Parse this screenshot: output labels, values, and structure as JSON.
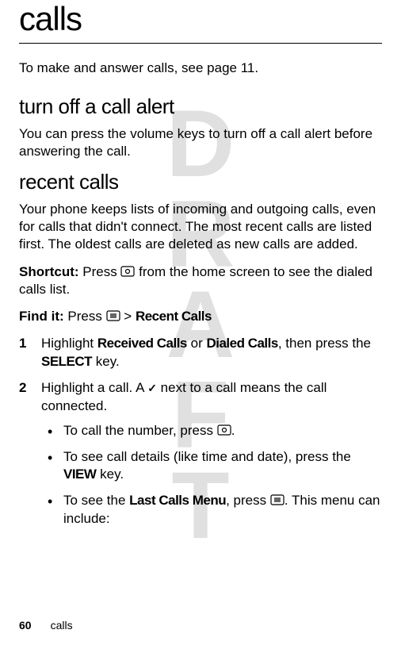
{
  "watermark": "DRAFT",
  "title": "calls",
  "intro": "To make and answer calls, see page 11.",
  "sections": {
    "turn_off": {
      "heading": "turn off a call alert",
      "body": "You can press the volume keys to turn off a call alert before answering the call."
    },
    "recent": {
      "heading": "recent calls",
      "body": "Your phone keeps lists of incoming and outgoing calls, even for calls that didn't connect. The most recent calls are listed first. The oldest calls are deleted as new calls are added.",
      "shortcut_label": "Shortcut:",
      "shortcut_pre": " Press ",
      "shortcut_post": " from the home screen to see the dialed calls list.",
      "shortcut_icon": "send-key-icon",
      "findit_label": "Find it:",
      "findit_pre": " Press ",
      "findit_sep": " > ",
      "findit_menu": "Recent Calls",
      "findit_icon": "menu-key-icon",
      "steps": {
        "s1_a": "Highlight ",
        "s1_b": "Received Calls",
        "s1_c": " or ",
        "s1_d": "Dialed Calls",
        "s1_e": ", then press the ",
        "s1_f": "SELECT",
        "s1_g": " key.",
        "s2_a": "Highlight a call. A ",
        "s2_b": " next to a call means the call connected.",
        "s2_check": "✓"
      },
      "bullets": {
        "b1_a": "To call the number, press ",
        "b1_b": ".",
        "b1_icon": "send-key-icon",
        "b2_a": "To see call details (like time and date), press the ",
        "b2_b": "VIEW",
        "b2_c": " key.",
        "b3_a": "To see the ",
        "b3_b": "Last Calls Menu",
        "b3_c": ", press ",
        "b3_d": ". This menu can include:",
        "b3_icon": "menu-key-icon"
      }
    }
  },
  "footer": {
    "page": "60",
    "section": "calls"
  }
}
